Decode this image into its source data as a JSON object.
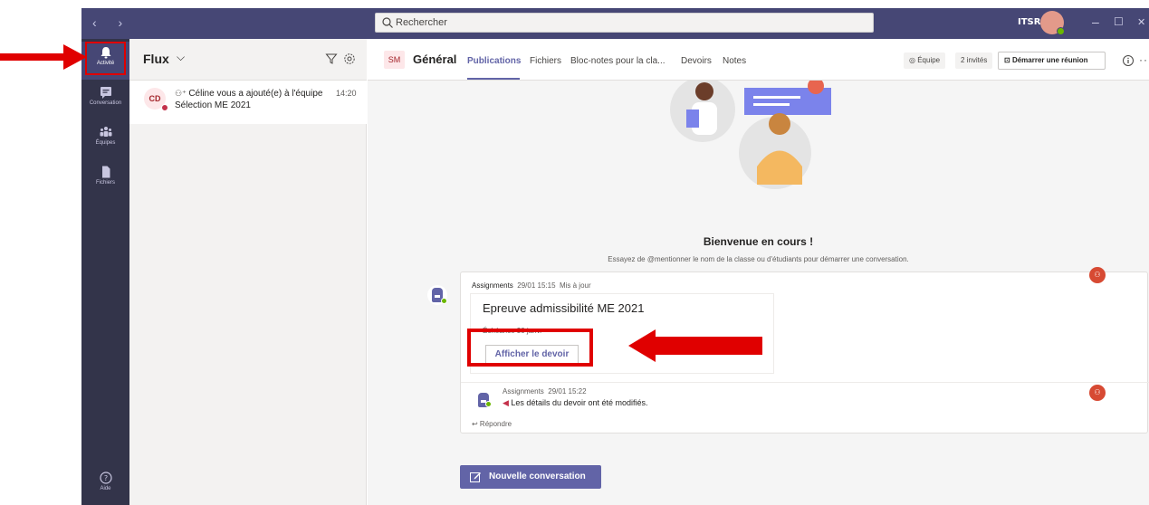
{
  "titlebar": {
    "nav_arrows": "‹ ›",
    "search_placeholder": "Rechercher",
    "tenant": "ITSRA",
    "win_minimize": "–",
    "win_maximize": "☐",
    "win_close": "✕"
  },
  "rail": {
    "items": [
      {
        "label": "Activité",
        "icon": "bell-icon"
      },
      {
        "label": "Conversation",
        "icon": "chat-icon"
      },
      {
        "label": "Équipes",
        "icon": "teams-icon"
      },
      {
        "label": "Fichiers",
        "icon": "files-icon"
      }
    ],
    "help": "Aide"
  },
  "activity": {
    "title": "Flux",
    "chevron": "⌵",
    "items": [
      {
        "avatar": "CD",
        "text": "Céline vous a ajouté(e) à l'équipe Sélection ME 2021",
        "time": "14:20"
      }
    ]
  },
  "channel": {
    "team_badge": "SM",
    "name": "Général",
    "tabs": [
      "Publications",
      "Fichiers",
      "Bloc-notes pour la cla...",
      "Devoirs",
      "Notes"
    ],
    "team_btn": "◎ Équipe",
    "guests": "2 invités",
    "meet_btn": "Démarrer une réunion",
    "more": "···"
  },
  "conversation": {
    "welcome_title": "Bienvenue en cours !",
    "welcome_sub": "Essayez de @mentionner le nom de la classe ou d'étudiants pour démarrer une conversation.",
    "post": {
      "author": "Assignments",
      "time": "29/01 15:15",
      "status": "Mis à jour",
      "card_title": "Epreuve admissibilité ME 2021",
      "due": "Échéance 30 janv.",
      "button": "Afficher le devoir"
    },
    "reply": {
      "author": "Assignments",
      "time": "29/01 15:22",
      "text": "Les détails du devoir ont été modifiés."
    },
    "reply_link": "↩ Répondre",
    "new_conversation": "Nouvelle conversation"
  },
  "colors": {
    "rail": "#33344a",
    "titlebar": "#464775",
    "accent": "#6264a7",
    "highlight": "#e00000"
  }
}
